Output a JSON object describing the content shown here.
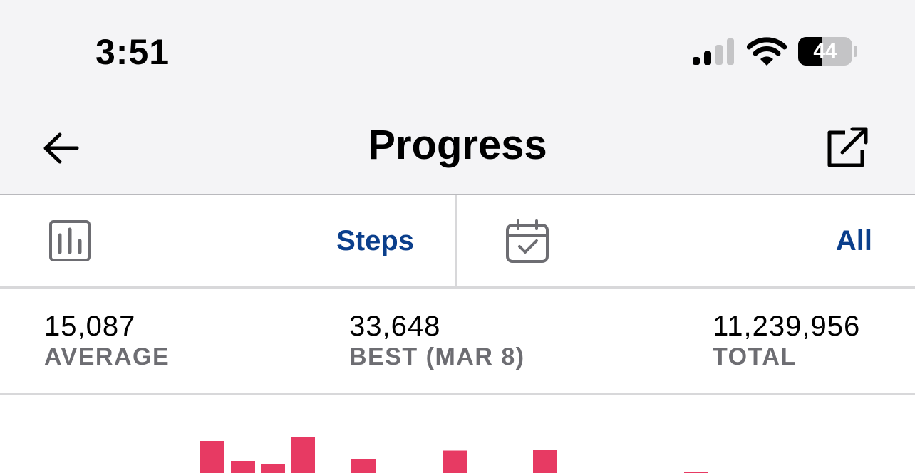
{
  "status_bar": {
    "time": "3:51",
    "battery_level": "44",
    "battery_fraction": 0.44
  },
  "nav": {
    "title": "Progress",
    "back_icon": "arrow-left-icon",
    "share_icon": "share-external-icon"
  },
  "selectors": {
    "metric": {
      "icon": "bar-chart-icon",
      "value": "Steps"
    },
    "range": {
      "icon": "calendar-check-icon",
      "value": "All"
    }
  },
  "stats": [
    {
      "value": "15,087",
      "label": "AVERAGE"
    },
    {
      "value": "33,648",
      "label": "BEST (MAR 8)"
    },
    {
      "value": "11,239,956",
      "label": "TOTAL"
    }
  ],
  "colors": {
    "accent": "#0b3f8c",
    "bar": "#e73a63",
    "secondary_text": "#6d6d72",
    "nav_background": "#f4f4f6"
  },
  "chart_data": {
    "type": "bar",
    "note_visible": "chart is cropped at bottom edge; only bar tops visible",
    "relative_values": [
      0.9,
      0.34,
      0.26,
      1.0,
      0.38,
      0.63,
      0.64,
      0.02
    ]
  }
}
